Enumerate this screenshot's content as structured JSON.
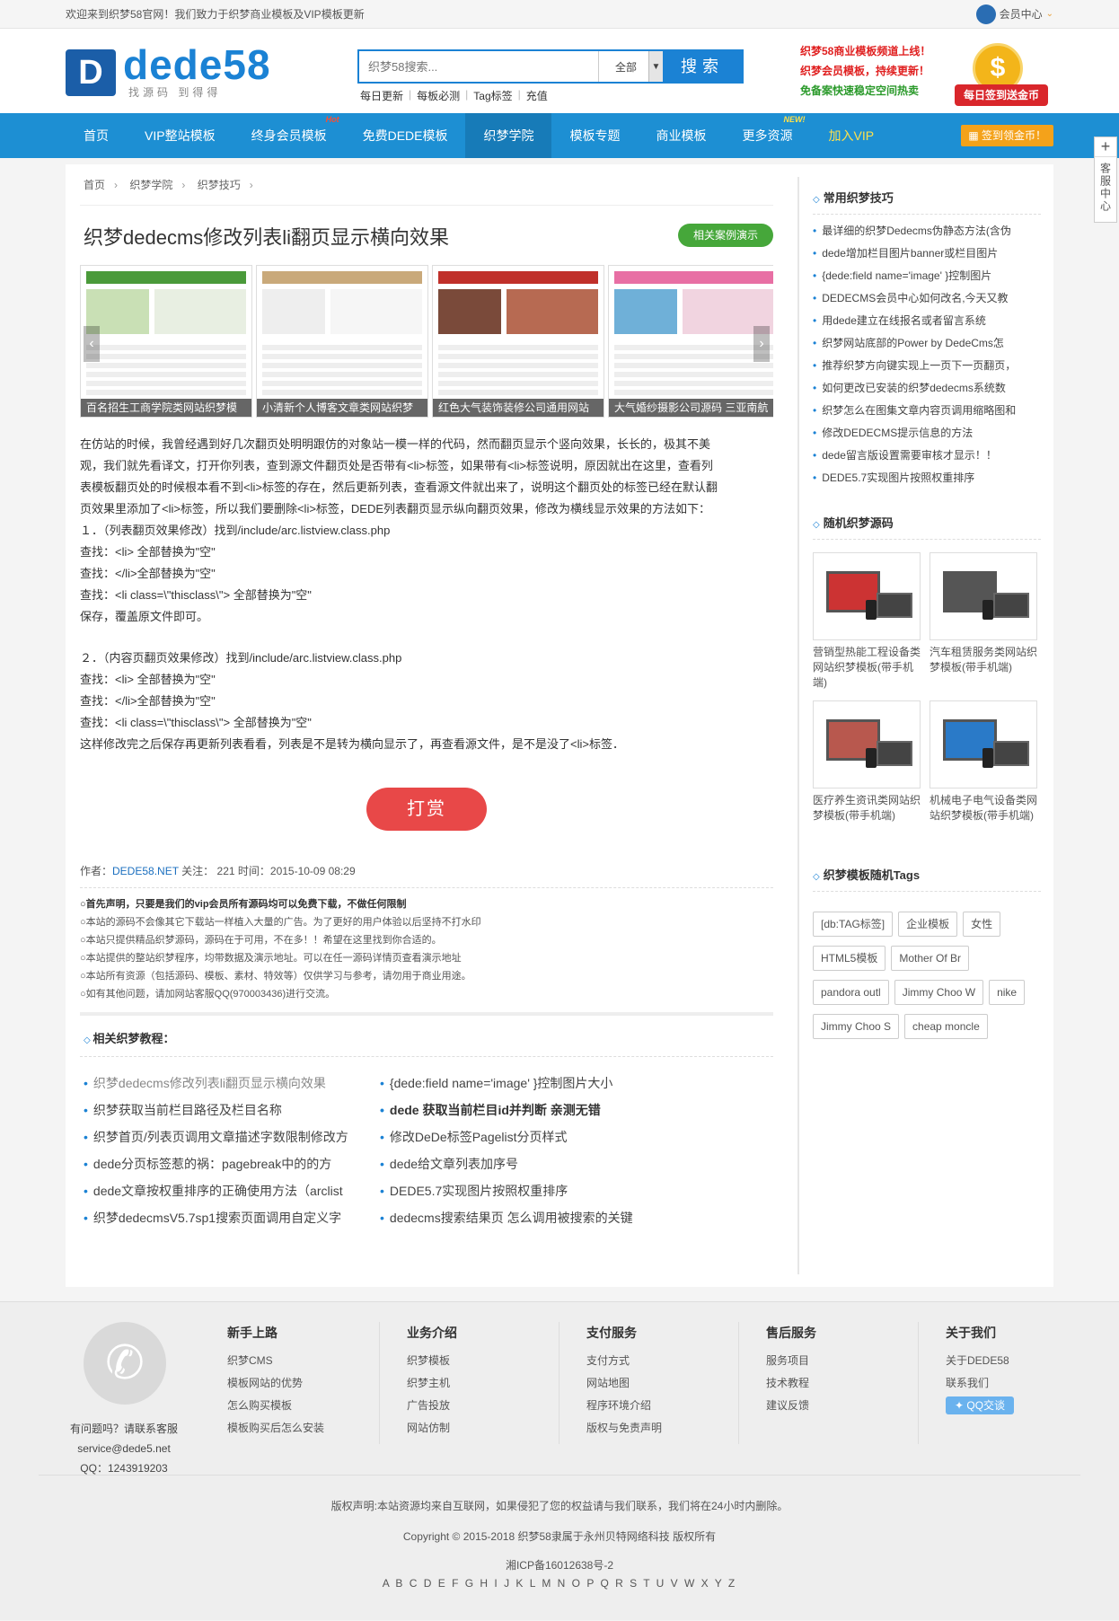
{
  "topbar": {
    "welcome": "欢迎来到织梦58官网！我们致力于织梦商业模板及VIP模板更新",
    "member": "会员中心"
  },
  "logo": {
    "mark": "D",
    "brand": "dede58",
    "slogan": "找源码  到得得"
  },
  "search": {
    "placeholder": "织梦58搜索...",
    "scope": "全部",
    "button": "搜索"
  },
  "quick_links": [
    "每日更新",
    "每板必测",
    "Tag标签",
    "充值"
  ],
  "header_notes": [
    {
      "text": "织梦58商业模板频道上线！",
      "color": "#e02020"
    },
    {
      "text": "织梦会员模板，持续更新！",
      "color": "#e02020"
    },
    {
      "text": "免备案快速稳定空间热卖",
      "color": "#2b9a2b"
    }
  ],
  "coin": {
    "symbol": "$",
    "ribbon": "每日签到送金币"
  },
  "nav": {
    "items": [
      {
        "label": "首页"
      },
      {
        "label": "VIP整站模板"
      },
      {
        "label": "终身会员模板",
        "tag": "Hot"
      },
      {
        "label": "免费DEDE模板"
      },
      {
        "label": "织梦学院",
        "active": true
      },
      {
        "label": "模板专题"
      },
      {
        "label": "商业模板"
      },
      {
        "label": "更多资源",
        "tag": "NEW!"
      },
      {
        "label": "加入VIP",
        "vip": true
      }
    ],
    "sign_in": "签到领金币！"
  },
  "float_service": {
    "plus": "+",
    "label": "客服中心"
  },
  "breadcrumb": [
    "首页",
    "织梦学院",
    "织梦技巧"
  ],
  "article": {
    "title": "织梦dedecms修改列表li翻页显示横向效果",
    "demo_button": "相关案例演示",
    "gallery": [
      "百名招生工商学院类网站织梦模",
      "小清新个人博客文章类网站织梦",
      "红色大气装饰装修公司通用网站",
      "大气婚纱摄影公司源码 三亚南航"
    ],
    "paragraphs": [
      "在仿站的时候，我曾经遇到好几次翻页处明明跟仿的对象站一模一样的代码，然而翻页显示个竖向效果，长长的，极其不美",
      "观，我们就先看译文，打开你列表，查到源文件翻页处是否带有<li>标签，如果带有<li>标签说明，原因就出在这里，查看列",
      "表模板翻页处的时候根本看不到<li>标签的存在，然后更新列表，查看源文件就出来了，说明这个翻页处的标签已经在默认翻",
      "页效果里添加了<li>标签，所以我们要删除<li>标签，DEDE列表翻页显示纵向翻页效果，修改为横线显示效果的方法如下：",
      "１．（列表翻页效果修改）找到/include/arc.listview.class.php",
      "查找：<li> 全部替换为\"空\"",
      "查找：</li>全部替换为\"空\"",
      "查找：<li class=\\\"thisclass\\\"> 全部替换为\"空\"",
      "保存，覆盖原文件即可。",
      "",
      "２．（内容页翻页效果修改）找到/include/arc.listview.class.php",
      "查找：<li> 全部替换为\"空\"",
      "查找：</li>全部替换为\"空\"",
      "查找：<li class=\\\"thisclass\\\"> 全部替换为\"空\"",
      "这样修改完之后保存再更新列表看看，列表是不是转为横向显示了，再查看源文件，是不是没了<li>标签．"
    ],
    "reward_button": "打赏",
    "meta": {
      "author_label": "作者：",
      "author": "DEDE58.NET",
      "views_label": " 关注：",
      "views": "221",
      "time_label": " 时间：",
      "time": "2015-10-09 08:29"
    },
    "notices": [
      "○首先声明，只要是我们的vip会员所有源码均可以免费下载，不做任何限制",
      "○本站的源码不会像其它下载站一样植入大量的广告。为了更好的用户体验以后坚持不打水印",
      "○本站只提供精品织梦源码，源码在于可用，不在多！！希望在这里找到你合适的。",
      "○本站提供的整站织梦程序，均带数据及演示地址。可以在任一源码详情页查看演示地址",
      "○本站所有资源（包括源码、模板、素材、特效等）仅供学习与参考，请勿用于商业用途。",
      "○如有其他问题，请加网站客服QQ(970003436)进行交流。"
    ],
    "related_heading": "相关织梦教程：",
    "related": [
      "织梦dedecms修改列表li翻页显示横向效果",
      "{dede:field name='image' }控制图片大小",
      "织梦获取当前栏目路径及栏目名称",
      "dede 获取当前栏目id并判断 亲测无错",
      "织梦首页/列表页调用文章描述字数限制修改方",
      "修改DeDe标签Pagelist分页样式",
      "dede分页标签惹的祸：pagebreak中的的方",
      "dede给文章列表加序号",
      "dede文章按权重排序的正确使用方法（arclist",
      "DEDE5.7实现图片按照权重排序",
      "织梦dedecmsV5.7sp1搜索页面调用自定义字",
      "dedecms搜索结果页 怎么调用被搜索的关键"
    ]
  },
  "sidebar": {
    "tips_heading": "常用织梦技巧",
    "tips": [
      "最详细的织梦Dedecms伪静态方法(含伪",
      "dede增加栏目图片banner或栏目图片",
      "{dede:field name='image' }控制图片",
      "DEDECMS会员中心如何改名,今天又教",
      "用dede建立在线报名或者留言系统",
      "织梦网站底部的Power by DedeCms怎",
      "推荐织梦方向键实现上一页下一页翻页，",
      "如何更改已安装的织梦dedecms系统数",
      "织梦怎么在图集文章内容页调用缩略图和",
      "修改DEDECMS提示信息的方法",
      "dede留言版设置需要审核才显示！！",
      "DEDE5.7实现图片按照权重排序"
    ],
    "random_heading": "随机织梦源码",
    "random": [
      "营销型热能工程设备类网站织梦模板(带手机端)",
      "汽车租赁服务类网站织梦模板(带手机端)",
      "医疗养生资讯类网站织梦模板(带手机端)",
      "机械电子电气设备类网站织梦模板(带手机端)"
    ],
    "tags_heading": "织梦模板随机Tags",
    "tags": [
      "[db:TAG标签]",
      "企业模板",
      "女性",
      "HTML5模板",
      "Mother Of Br",
      "pandora outl",
      "Jimmy Choo W",
      "nike",
      "Jimmy Choo S",
      "cheap moncle"
    ]
  },
  "footer": {
    "phone_icon": "✆",
    "contact": [
      "有问题吗？请联系客服",
      "service@dede5.net",
      "QQ：1243919203"
    ],
    "columns": [
      {
        "title": "新手上路",
        "links": [
          "织梦CMS",
          "模板网站的优势",
          "怎么购买模板",
          "模板购买后怎么安装"
        ]
      },
      {
        "title": "业务介绍",
        "links": [
          "织梦模板",
          "织梦主机",
          "广告投放",
          "网站仿制"
        ]
      },
      {
        "title": "支付服务",
        "links": [
          "支付方式",
          "网站地图",
          "程序环境介绍",
          "版权与免责声明"
        ]
      },
      {
        "title": "售后服务",
        "links": [
          "服务项目",
          "技术教程",
          "建议反馈"
        ]
      },
      {
        "title": "关于我们",
        "links": [
          "关于DEDE58",
          "联系我们"
        ],
        "qq": "QQ交谈"
      }
    ],
    "disclaimer": "版权声明:本站资源均来自互联网，如果侵犯了您的权益请与我们联系，我们将在24小时内删除。",
    "copyright": "Copyright © 2015-2018 织梦58隶属于永州贝特网络科技 版权所有",
    "icp": "湘ICP备16012638号-2",
    "az": "A B C D E F G H I J K L M N O P Q R S T U V W X Y Z"
  },
  "colors": {
    "brand": "#1d8fd3",
    "active_nav": "#177bb8",
    "reward": "#e84848",
    "demo": "#46a73a"
  }
}
